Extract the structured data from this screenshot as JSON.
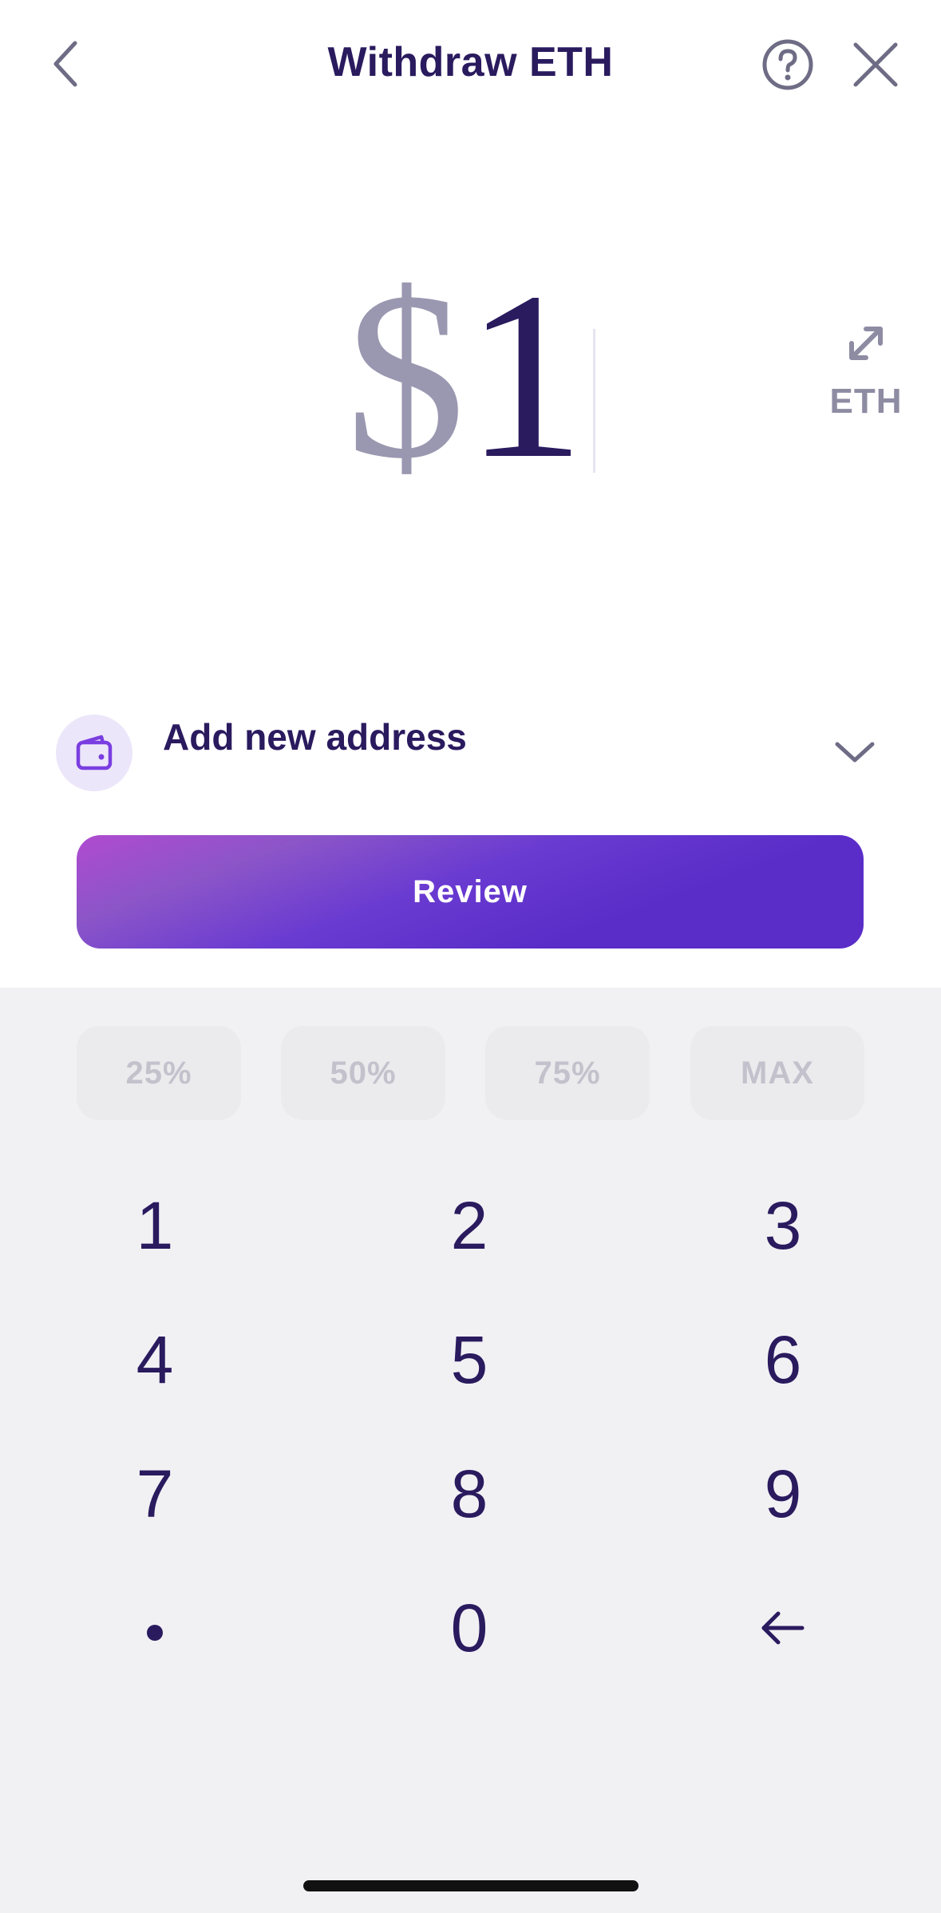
{
  "header": {
    "title": "Withdraw ETH",
    "back_icon": "chevron-left-icon",
    "help_icon": "question-circle-icon",
    "close_icon": "close-icon"
  },
  "amount": {
    "currency_symbol": "$",
    "value": "1"
  },
  "unit_toggle": {
    "label": "ETH",
    "icon": "swap-arrows-icon"
  },
  "address": {
    "label": "Add new address",
    "icon": "wallet-icon",
    "chevron_icon": "chevron-down-icon"
  },
  "review_button": {
    "label": "Review"
  },
  "quick_amounts": [
    "25%",
    "50%",
    "75%",
    "MAX"
  ],
  "keypad": {
    "keys": [
      "1",
      "2",
      "3",
      "4",
      "5",
      "6",
      "7",
      "8",
      "9",
      ".",
      "0",
      "←"
    ]
  },
  "colors": {
    "primary_text": "#2a1a5e",
    "muted_text": "#9a97b0",
    "accent": "#5a2dc9",
    "accent_light": "#ece6fa",
    "keypad_bg": "#f1f1f4"
  }
}
